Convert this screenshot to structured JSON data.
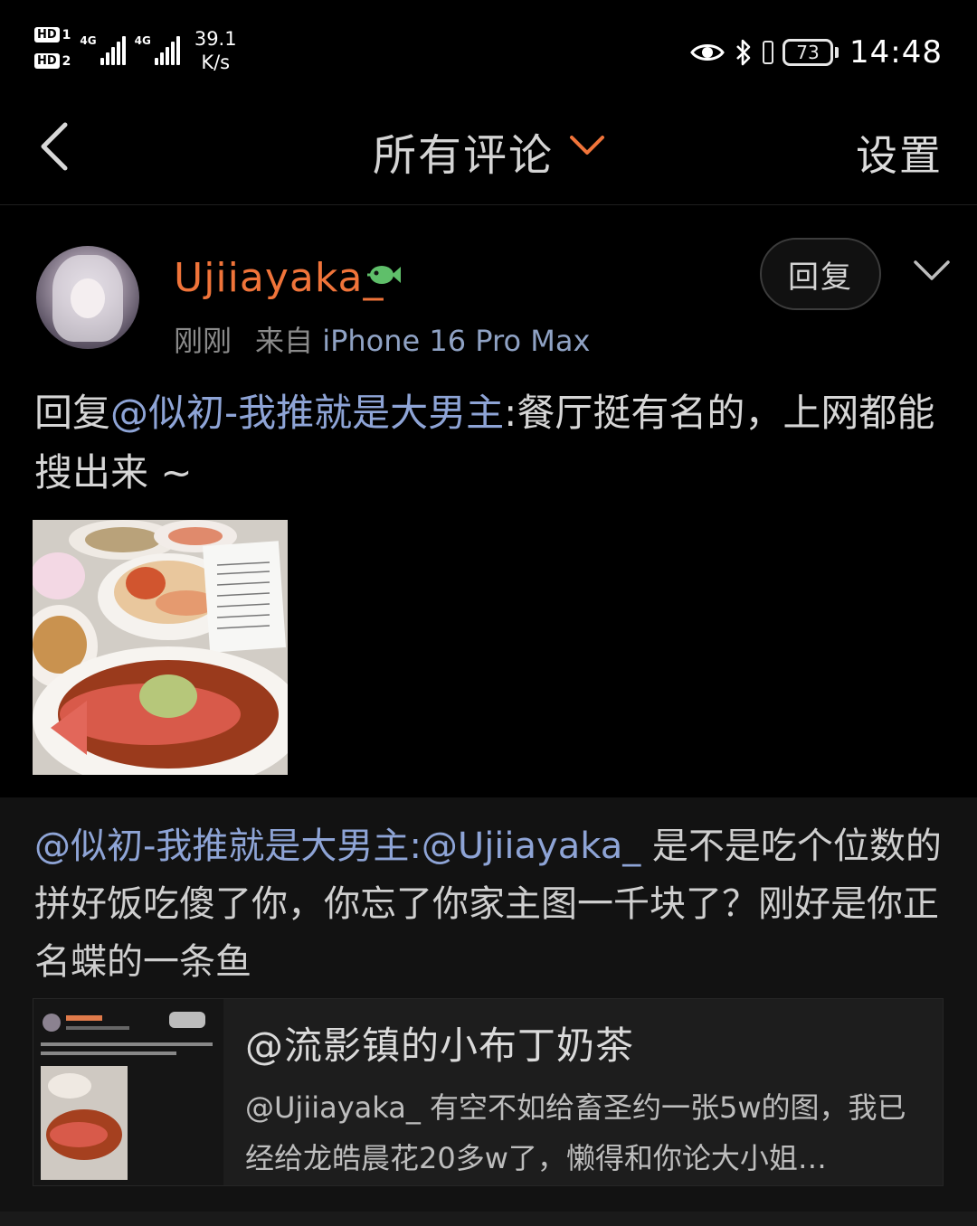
{
  "status_bar": {
    "sim1": "HD",
    "sim1_num": "1",
    "sim2": "HD",
    "sim2_num": "2",
    "net1": "4G",
    "net2": "4G",
    "speed_value": "39.1",
    "speed_unit": "K/s",
    "battery": "73",
    "time": "14:48"
  },
  "navbar": {
    "title": "所有评论",
    "settings": "设置",
    "accent_color": "#f0743a"
  },
  "comment": {
    "username": "Ujiiayaka_",
    "time": "刚刚",
    "from_label": "来自",
    "device": "iPhone 16 Pro Max",
    "reply_button": "回复",
    "text_prefix": "回复",
    "mention": "@似初-我推就是大男主",
    "text_rest": ":餐厅挺有名的，上网都能搜出来 ~"
  },
  "original": {
    "mention1": "@似初-我推就是大男主",
    "mention2": ":@Ujiiayaka_",
    "text": " 是不是吃个位数的拼好饭吃傻了你，你忘了你家主图一千块了？刚好是你正名蝶的一条鱼",
    "card": {
      "title": "@流影镇的小布丁奶茶",
      "body": "@Ujiiayaka_ 有空不如给畜圣约一张5w的图，我已经给龙皓晨花20多w了，懒得和你论大小姐…"
    }
  }
}
